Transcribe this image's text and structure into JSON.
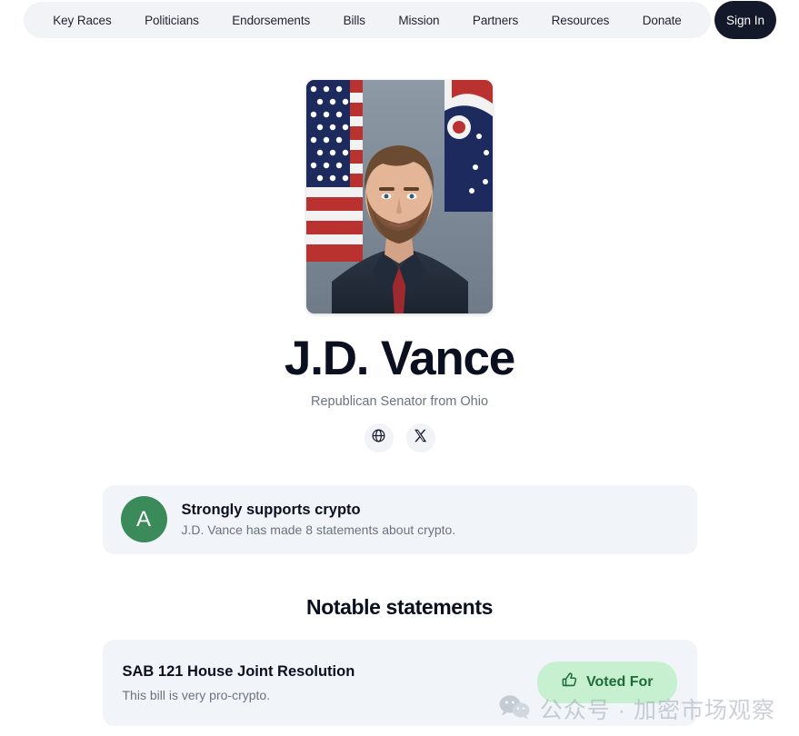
{
  "nav": {
    "items": [
      {
        "label": "Key Races",
        "name": "key-races"
      },
      {
        "label": "Politicians",
        "name": "politicians"
      },
      {
        "label": "Endorsements",
        "name": "endorsements"
      },
      {
        "label": "Bills",
        "name": "bills"
      },
      {
        "label": "Mission",
        "name": "mission"
      },
      {
        "label": "Partners",
        "name": "partners"
      },
      {
        "label": "Resources",
        "name": "resources"
      },
      {
        "label": "Donate",
        "name": "donate"
      }
    ],
    "sign_in_label": "Sign In"
  },
  "profile": {
    "name": "J.D. Vance",
    "role": "Republican Senator from Ohio",
    "portrait_alt": "Official portrait of J.D. Vance in navy suit with red tie, US flag and Ohio flag behind",
    "socials": [
      {
        "icon": "globe-icon",
        "name": "website-link"
      },
      {
        "icon": "x-icon",
        "name": "x-twitter-link"
      }
    ]
  },
  "rating": {
    "grade": "A",
    "grade_color": "#3a8a5a",
    "title": "Strongly supports crypto",
    "subtitle": "J.D. Vance has made 8 statements about crypto."
  },
  "statements": {
    "section_title": "Notable statements",
    "items": [
      {
        "title": "SAB 121 House Joint Resolution",
        "description": "This bill is very pro-crypto.",
        "badge_label": "Voted For",
        "badge_icon": "thumbs-up-icon",
        "badge_bg": "#c6f0cf",
        "badge_text_color": "#1e6b3a"
      }
    ]
  },
  "watermark": {
    "text": "公众号 · 加密市场观察"
  }
}
